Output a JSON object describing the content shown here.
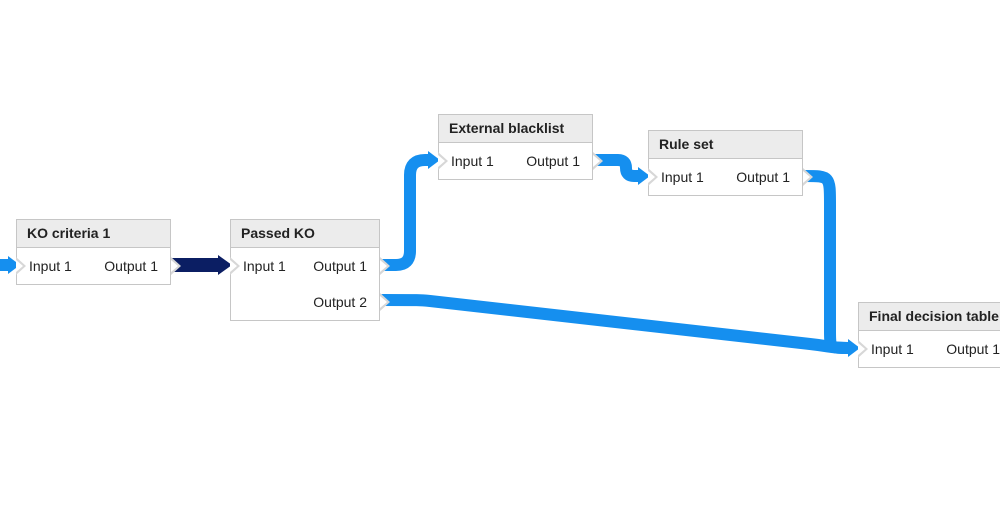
{
  "nodes": {
    "ko_criteria": {
      "title": "KO criteria 1",
      "inputs": [
        "Input 1"
      ],
      "outputs": [
        "Output 1"
      ]
    },
    "passed_ko": {
      "title": "Passed KO",
      "inputs": [
        "Input 1"
      ],
      "outputs": [
        "Output 1",
        "Output 2"
      ]
    },
    "external_blacklist": {
      "title": "External blacklist",
      "inputs": [
        "Input 1"
      ],
      "outputs": [
        "Output 1"
      ]
    },
    "rule_set": {
      "title": "Rule set",
      "inputs": [
        "Input 1"
      ],
      "outputs": [
        "Output 1"
      ]
    },
    "final_decision": {
      "title": "Final decision table",
      "inputs": [
        "Input 1"
      ],
      "outputs": [
        "Output 1"
      ]
    }
  },
  "edges": [
    {
      "from": "entry",
      "to": "ko_criteria.in1"
    },
    {
      "from": "ko_criteria.out1",
      "to": "passed_ko.in1"
    },
    {
      "from": "passed_ko.out1",
      "to": "external_blacklist.in1"
    },
    {
      "from": "passed_ko.out2",
      "to": "final_decision.in1"
    },
    {
      "from": "external_blacklist.out1",
      "to": "rule_set.in1"
    },
    {
      "from": "rule_set.out1",
      "to": "final_decision.in1"
    }
  ],
  "colors": {
    "edge_active": "#158fef",
    "edge_dark": "#0b1e63",
    "node_border": "#c6c6c6",
    "node_header_bg": "#ececec"
  }
}
